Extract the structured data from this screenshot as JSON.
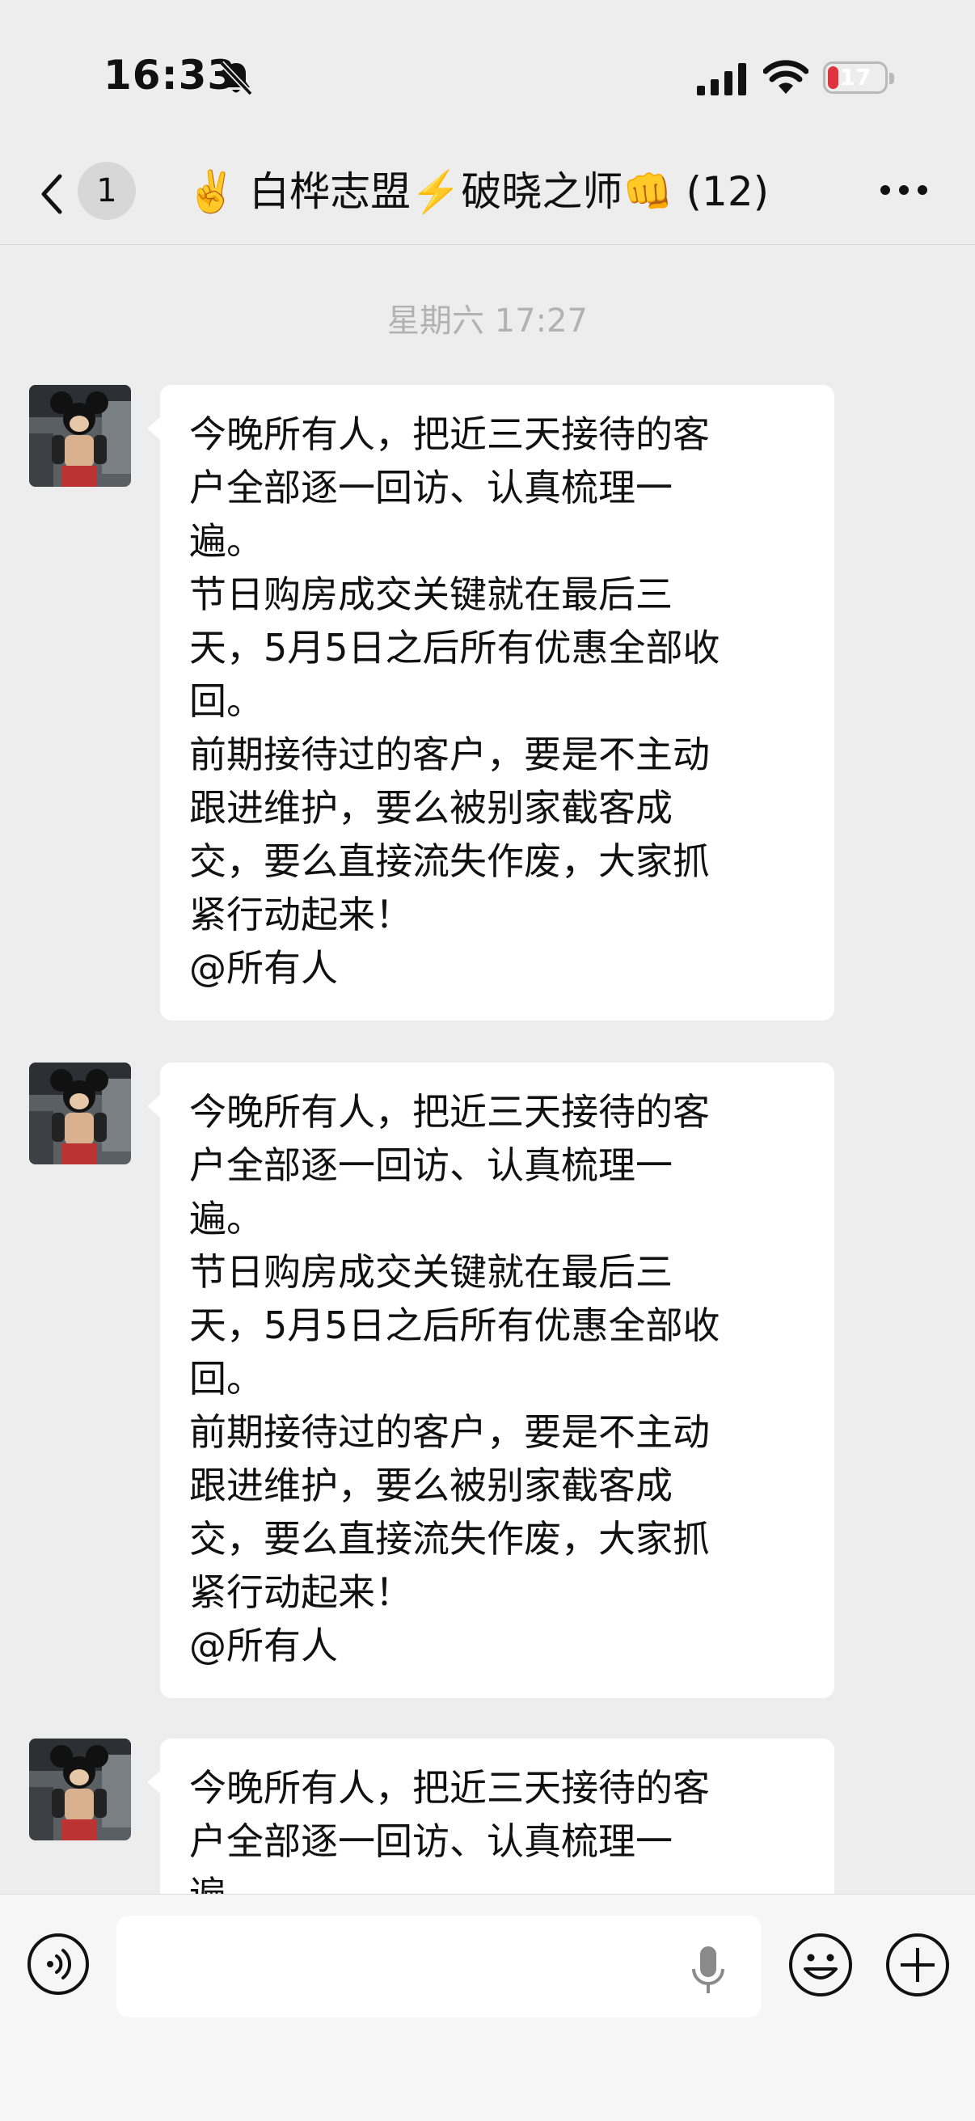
{
  "status_bar": {
    "time": "16:33",
    "battery_level": "17"
  },
  "nav": {
    "unread_count": "1",
    "title": "✌️ 白桦志盟⚡️破晓之师👊 (12)"
  },
  "chat": {
    "timestamp": "星期六 17:27",
    "messages": [
      {
        "text": "今晚所有人，把近三天接待的客\n户全部逐一回访、认真梳理一\n遍。\n节日购房成交关键就在最后三\n天，5月5日之后所有优惠全部收\n回。\n前期接待过的客户，要是不主动\n跟进维护，要么被别家截客成\n交，要么直接流失作废，大家抓\n紧行动起来！\n@所有人"
      },
      {
        "text": "今晚所有人，把近三天接待的客\n户全部逐一回访、认真梳理一\n遍。\n节日购房成交关键就在最后三\n天，5月5日之后所有优惠全部收\n回。\n前期接待过的客户，要是不主动\n跟进维护，要么被别家截客成\n交，要么直接流失作废，大家抓\n紧行动起来！\n@所有人"
      },
      {
        "text": "今晚所有人，把近三天接待的客\n户全部逐一回访、认真梳理一\n遍。"
      }
    ]
  },
  "input_bar": {
    "placeholder": ""
  },
  "colors": {
    "background": "#ededed",
    "bubble": "#ffffff",
    "battery_low": "#e0343d",
    "timestamp": "#b2b2b2"
  },
  "icons": [
    "bell-slash-icon",
    "signal-icon",
    "wifi-icon",
    "battery-icon",
    "back-chevron-icon",
    "more-icon",
    "voice-icon",
    "mic-icon",
    "emoji-icon",
    "plus-icon"
  ]
}
